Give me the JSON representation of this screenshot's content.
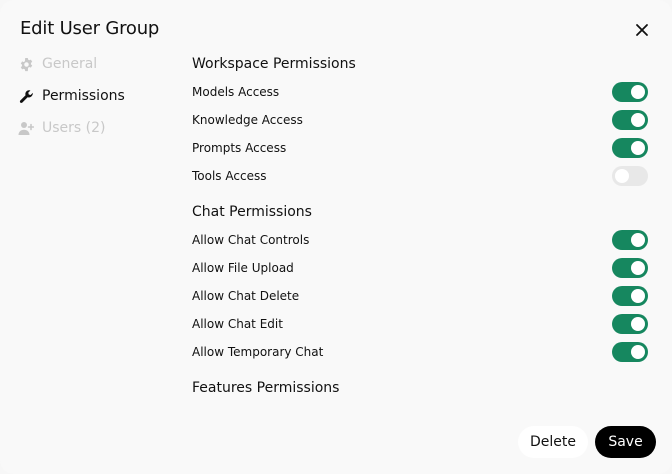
{
  "modal": {
    "title": "Edit User Group"
  },
  "sidebar": {
    "items": [
      {
        "label": "General",
        "icon": "gear-icon",
        "active": false
      },
      {
        "label": "Permissions",
        "icon": "wrench-icon",
        "active": true
      },
      {
        "label": "Users (2)",
        "icon": "user-plus-icon",
        "active": false
      }
    ]
  },
  "sections": {
    "workspace": {
      "title": "Workspace Permissions",
      "items": [
        {
          "label": "Models Access",
          "enabled": true
        },
        {
          "label": "Knowledge Access",
          "enabled": true
        },
        {
          "label": "Prompts Access",
          "enabled": true
        },
        {
          "label": "Tools Access",
          "enabled": false
        }
      ]
    },
    "chat": {
      "title": "Chat Permissions",
      "items": [
        {
          "label": "Allow Chat Controls",
          "enabled": true
        },
        {
          "label": "Allow File Upload",
          "enabled": true
        },
        {
          "label": "Allow Chat Delete",
          "enabled": true
        },
        {
          "label": "Allow Chat Edit",
          "enabled": true
        },
        {
          "label": "Allow Temporary Chat",
          "enabled": true
        }
      ]
    },
    "features": {
      "title": "Features Permissions"
    }
  },
  "footer": {
    "delete_label": "Delete",
    "save_label": "Save"
  },
  "colors": {
    "toggle_on": "#16875f",
    "toggle_off": "#e8e8e8",
    "save_bg": "#000000"
  }
}
